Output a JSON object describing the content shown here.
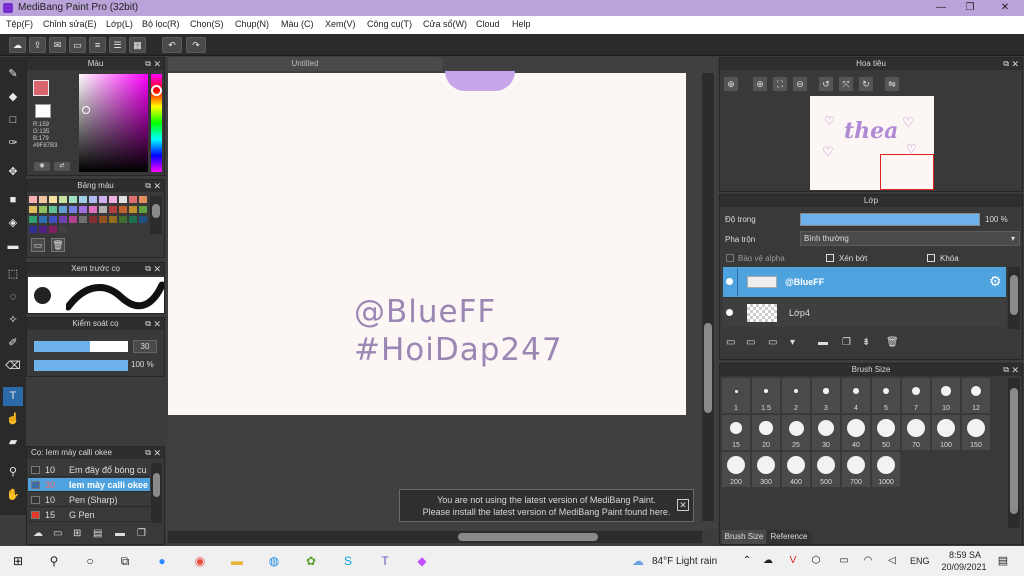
{
  "window": {
    "title": "MediBang Paint Pro (32bit)",
    "minimize": "—",
    "maximize": "❐",
    "close": "✕"
  },
  "menu": [
    "Tệp(F)",
    "Chỉnh sửa(E)",
    "Lớp(L)",
    "Bộ lọc(R)",
    "Chọn(S)",
    "Chụp(N)",
    "Màu (C)",
    "Xem(V)",
    "Công cụ(T)",
    "Cửa sổ(W)",
    "Cloud",
    "Help"
  ],
  "toolbar": {
    "undo_icon": "undo-icon",
    "redo_icon": "redo-icon"
  },
  "color_panel": {
    "title": "Màu",
    "r": "R:159",
    "g": "G:135",
    "b": "B:179",
    "hex": "#9F87B3",
    "primary": "#d8646d",
    "secondary": "#ffffff",
    "hue_highlight": "#9f87b3"
  },
  "palette_panel": {
    "title": "Bảng màu"
  },
  "brush_preview": {
    "title": "Xem trước cọ"
  },
  "brush_control": {
    "title": "Kiểm soát cọ",
    "size": "30",
    "opacity": "100 %",
    "size_fraction": 0.6,
    "opacity_fraction": 1.0
  },
  "brush_list": {
    "title": "Cọ: Iem mày calli okee",
    "items": [
      {
        "size": "10",
        "name": "Em đây đổ bóng cu",
        "color": "#333333",
        "selected": false
      },
      {
        "size": "30",
        "name": "Iem mày calli okee",
        "color": "#3f6ea6",
        "selected": true
      },
      {
        "size": "10",
        "name": "Pen (Sharp)",
        "color": "#333333",
        "selected": false
      },
      {
        "size": "15",
        "name": "G Pen",
        "color": "#e23a2a",
        "selected": false
      }
    ]
  },
  "document": {
    "tab": "Untitled",
    "line1": "@BlueFF",
    "line2": "#HoiDap247"
  },
  "notice": {
    "line1": "You are not using the latest version of MediBang Paint.",
    "line2": "Please install the latest version of MediBang Paint found here.",
    "close": "✕"
  },
  "navigator": {
    "title": "Hoa tiêu",
    "preview_text": "thea"
  },
  "layer_panel": {
    "title": "Lớp",
    "opacity_label": "Độ trong",
    "opacity_value": "100 %",
    "blend_label": "Pha trộn",
    "blend_value": "Bình thường",
    "protect_alpha": "Bảo vệ alpha",
    "clipping": "Xén bớt",
    "lock": "Khóa",
    "layers": [
      {
        "name": "@BlueFF",
        "selected": true
      },
      {
        "name": "Lớp4",
        "selected": false
      }
    ]
  },
  "brush_size_panel": {
    "title": "Brush Size",
    "sizes": [
      "1",
      "1.5",
      "2",
      "3",
      "4",
      "5",
      "7",
      "10",
      "12",
      "15",
      "20",
      "25",
      "30",
      "40",
      "50",
      "70",
      "100",
      "150",
      "200",
      "300",
      "400",
      "500",
      "700",
      "1000"
    ],
    "tabs": [
      "Brush Size",
      "Reference"
    ]
  },
  "taskbar": {
    "weather": "84°F  Light rain",
    "lang": "ENG",
    "time": "8:59 SA",
    "date": "20/09/2021"
  }
}
